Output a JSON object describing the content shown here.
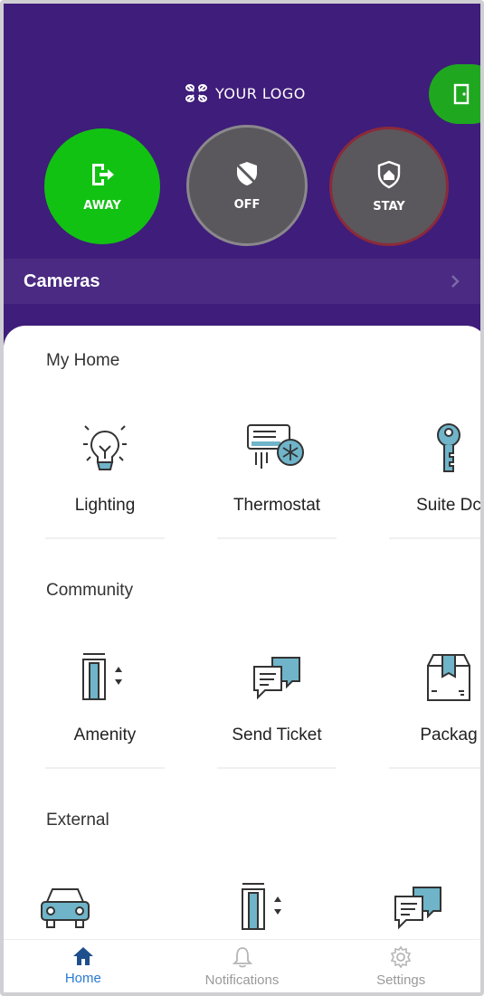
{
  "header": {
    "logo_text": "YOUR LOGO",
    "colors": {
      "background": "#3f1d7a",
      "away": "#12c212",
      "inactive": "#5a585c",
      "stay_border": "#8b2a3a",
      "door": "#1fa81f"
    }
  },
  "modes": [
    {
      "label": "AWAY",
      "icon": "exit-icon",
      "state": "active"
    },
    {
      "label": "OFF",
      "icon": "shield-off-icon",
      "state": "inactive"
    },
    {
      "label": "STAY",
      "icon": "shield-home-icon",
      "state": "inactive"
    }
  ],
  "cameras": {
    "title": "Cameras"
  },
  "sections": [
    {
      "title": "My Home",
      "items": [
        "Lighting",
        "Thermostat",
        "Suite Dc"
      ]
    },
    {
      "title": "Community",
      "items": [
        "Amenity",
        "Send Ticket",
        "Packag"
      ]
    },
    {
      "title": "External",
      "items": [
        "",
        "",
        ""
      ]
    }
  ],
  "tabs": [
    {
      "label": "Home",
      "icon": "home-icon",
      "active": true
    },
    {
      "label": "Notifications",
      "icon": "bell-icon",
      "active": false
    },
    {
      "label": "Settings",
      "icon": "gear-icon",
      "active": false
    }
  ]
}
